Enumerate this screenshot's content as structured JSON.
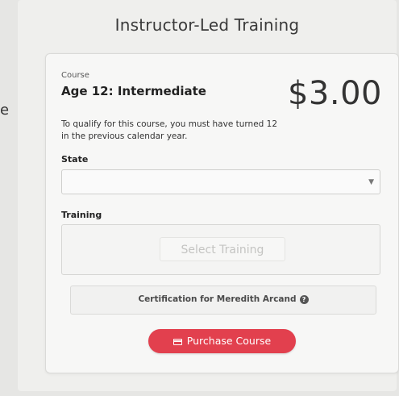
{
  "panel": {
    "title": "Instructor-Led Training"
  },
  "course": {
    "kicker": "Course",
    "name": "Age 12: Intermediate",
    "price": "$3.00",
    "qualify_text": "To qualify for this course, you must have turned 12 in the previous calendar year."
  },
  "form": {
    "state_label": "State",
    "state_value": "",
    "training_label": "Training",
    "select_training_label": "Select Training"
  },
  "certification": {
    "text": "Certification for Meredith Arcand"
  },
  "purchase": {
    "label": "Purchase Course"
  },
  "edge": {
    "left_glyph": "e"
  },
  "colors": {
    "accent": "#e2404e",
    "background": "#e6e6e4",
    "card": "#f7f7f6"
  },
  "icons": {
    "dropdown": "chevron-down-icon",
    "help": "help-icon",
    "payment": "credit-card-icon"
  }
}
